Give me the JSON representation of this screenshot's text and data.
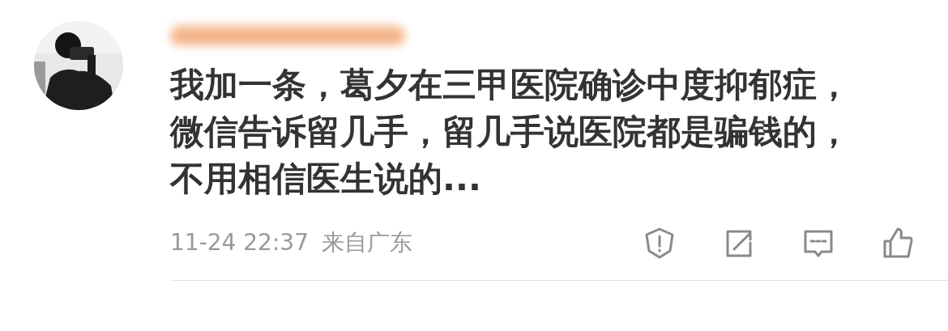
{
  "comment": {
    "avatar": {
      "kind": "picture"
    },
    "text_lines": [
      "我加一条，葛夕在三甲医院确诊中度抑郁症，",
      "微信告诉留几手，留几手说医院都是骗钱的，",
      "不用相信医生说的..."
    ],
    "time": "11-24 22:37",
    "location": "来自广东",
    "actions": [
      {
        "kind": "report"
      },
      {
        "kind": "share"
      },
      {
        "kind": "comment"
      },
      {
        "kind": "like"
      }
    ]
  }
}
